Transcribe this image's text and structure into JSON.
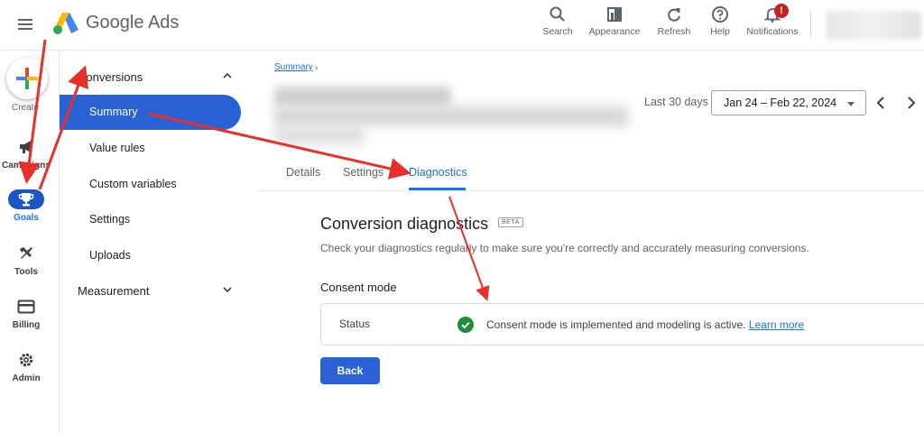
{
  "app": {
    "brand_google": "Google",
    "brand_ads": "Ads"
  },
  "toolbar": {
    "items": [
      {
        "label": "Search",
        "icon": "search-icon"
      },
      {
        "label": "Appearance",
        "icon": "appearance-icon"
      },
      {
        "label": "Refresh",
        "icon": "refresh-icon"
      },
      {
        "label": "Help",
        "icon": "help-icon"
      },
      {
        "label": "Notifications",
        "icon": "bell-icon"
      }
    ],
    "notification_badge": "!"
  },
  "rail": {
    "create_label": "Create",
    "items": [
      {
        "label": "Campaigns",
        "icon": "megaphone-icon"
      },
      {
        "label": "Goals",
        "icon": "trophy-icon",
        "active": true
      },
      {
        "label": "Tools",
        "icon": "tools-icon"
      },
      {
        "label": "Billing",
        "icon": "credit-card-icon"
      },
      {
        "label": "Admin",
        "icon": "gear-icon"
      }
    ]
  },
  "subnav": {
    "conversions": "Conversions",
    "items": [
      "Summary",
      "Value rules",
      "Custom variables",
      "Settings",
      "Uploads"
    ],
    "active_item": "Summary",
    "measurement": "Measurement"
  },
  "main": {
    "breadcrumb": "Summary",
    "date_range_label": "Last 30 days",
    "date_range_value": "Jan 24 – Feb 22, 2024",
    "tabs": [
      "Details",
      "Settings",
      "Diagnostics"
    ],
    "active_tab": "Diagnostics",
    "section_title": "Conversion diagnostics",
    "beta_badge": "BETA",
    "section_desc": "Check your diagnostics regularly to make sure you're correctly and accurately measuring conversions.",
    "consent_heading": "Consent mode",
    "status_key": "Status",
    "status_value": "Consent mode is implemented and modeling is active.",
    "learn_more": "Learn more",
    "back_button": "Back"
  },
  "colors": {
    "accent": "#1a73e8",
    "active_nav": "#2a62d6",
    "success": "#1e8e3e",
    "annotation": "#e8302a"
  }
}
